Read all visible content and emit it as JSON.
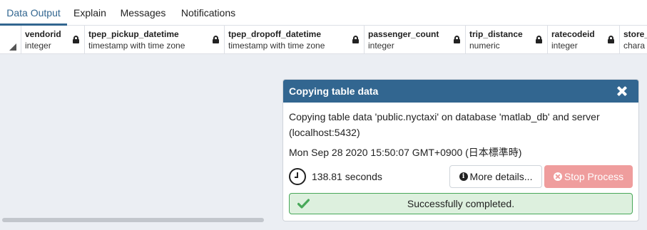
{
  "tabs": [
    {
      "label": "Data Output",
      "active": true
    },
    {
      "label": "Explain",
      "active": false
    },
    {
      "label": "Messages",
      "active": false
    },
    {
      "label": "Notifications",
      "active": false
    }
  ],
  "columns": [
    {
      "name": "vendorid",
      "type": "integer"
    },
    {
      "name": "tpep_pickup_datetime",
      "type": "timestamp with time zone"
    },
    {
      "name": "tpep_dropoff_datetime",
      "type": "timestamp with time zone"
    },
    {
      "name": "passenger_count",
      "type": "integer"
    },
    {
      "name": "trip_distance",
      "type": "numeric"
    },
    {
      "name": "ratecodeid",
      "type": "integer"
    },
    {
      "name": "store_",
      "type": "chara"
    }
  ],
  "dialog": {
    "title": "Copying table data",
    "message": "Copying table data 'public.nyctaxi' on database 'matlab_db' and server (localhost:5432)",
    "timestamp": "Mon Sep 28 2020 15:50:07 GMT+0900 (日本標準時)",
    "duration": "138.81 seconds",
    "details_label": "More details...",
    "stop_label": "Stop Process",
    "status": "Successfully completed."
  },
  "colors": {
    "accent": "#326690",
    "stop_button": "#ef9d9d",
    "success_bg": "#ddf0de",
    "success_border": "#48a859"
  },
  "icons": [
    "lock-icon",
    "close-icon",
    "clock-icon",
    "info-icon",
    "stop-icon",
    "check-icon"
  ]
}
